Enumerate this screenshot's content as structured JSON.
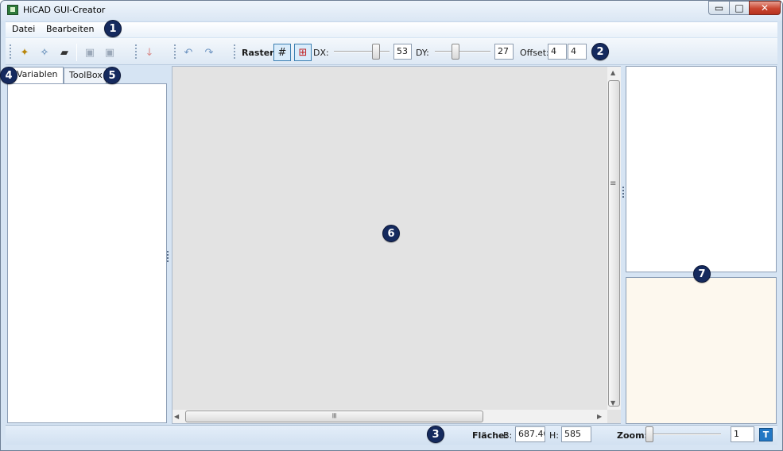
{
  "window": {
    "title": "HiCAD GUI-Creator",
    "minimize_symbol": "▭",
    "maximize_symbol": "□",
    "close_symbol": "✕"
  },
  "menu": {
    "items": [
      "Datei",
      "Bearbeiten"
    ]
  },
  "toolbar": {
    "buttons": [
      {
        "icon": "new-file-icon",
        "glyph": "✦",
        "enabled": true
      },
      {
        "icon": "new-dialog-icon",
        "glyph": "✧",
        "enabled": true
      },
      {
        "icon": "open-folder-icon",
        "glyph": "▰",
        "enabled": true
      },
      {
        "icon": "save-icon",
        "glyph": "▣",
        "enabled": false
      },
      {
        "icon": "save-as-icon",
        "glyph": "▣",
        "enabled": false
      },
      {
        "icon": "pin-icon",
        "glyph": "↓",
        "enabled": false
      },
      {
        "icon": "undo-icon",
        "glyph": "↶",
        "enabled": false
      },
      {
        "icon": "redo-icon",
        "glyph": "↷",
        "enabled": false
      }
    ],
    "raster_label": "Raster:",
    "grid_glyph": "#",
    "snap_glyph": "⊞",
    "dx_label": "DX:",
    "dx_value": "53",
    "dx_slider_level": 0.8,
    "dy_label": "DY:",
    "dy_value": "27",
    "dy_slider_level": 0.35,
    "offset_label": "Offset:",
    "offset_x": "4",
    "offset_y": "4"
  },
  "left_panel": {
    "tabs": [
      {
        "label": "Variablen",
        "active": true
      },
      {
        "label": "ToolBox",
        "active": false
      }
    ]
  },
  "scrollbars": {
    "up": "▲",
    "down": "▼",
    "left": "◀",
    "right": "▶",
    "grip": "≡"
  },
  "statusbar": {
    "flaeche_label": "Fläche:",
    "b_label": "B:",
    "b_value": "687.40",
    "h_label": "H:",
    "h_value": "585",
    "zoom_label": "Zoom:",
    "zoom_value": "1",
    "zoom_slider_level": 0.0,
    "zoom_button_glyph": "T"
  },
  "badges": [
    "1",
    "2",
    "3",
    "4",
    "5",
    "6",
    "7"
  ],
  "colors": {
    "badge": "#152a5e",
    "canvas": "#e3e3e3",
    "properties_bg": "#fdf8ee",
    "frame": "#d6e4f3"
  }
}
